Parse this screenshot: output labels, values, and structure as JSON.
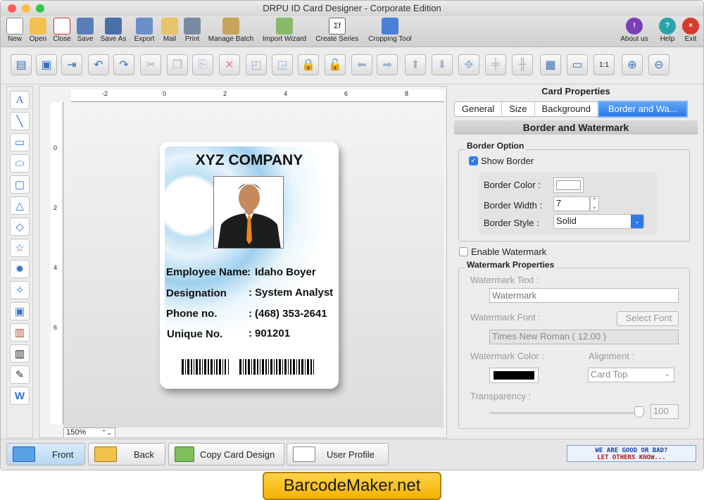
{
  "window": {
    "title": "DRPU ID Card Designer - Corporate Edition"
  },
  "toolbar": [
    {
      "label": "New",
      "icon": "new-icon"
    },
    {
      "label": "Open",
      "icon": "open-icon"
    },
    {
      "label": "Close",
      "icon": "close-file-icon"
    },
    {
      "label": "Save",
      "icon": "save-icon"
    },
    {
      "label": "Save As",
      "icon": "save-as-icon"
    },
    {
      "label": "Export",
      "icon": "export-icon"
    },
    {
      "label": "Mail",
      "icon": "mail-icon"
    },
    {
      "label": "Print",
      "icon": "print-icon"
    },
    {
      "label": "Manage Batch",
      "icon": "batch-icon"
    },
    {
      "label": "Import Wizard",
      "icon": "import-wizard-icon"
    },
    {
      "label": "Create Series",
      "icon": "series-icon"
    },
    {
      "label": "Cropping Tool",
      "icon": "crop-icon"
    },
    {
      "label": "About us",
      "icon": "about-icon"
    },
    {
      "label": "Help",
      "icon": "help-icon"
    },
    {
      "label": "Exit",
      "icon": "exit-icon"
    }
  ],
  "card": {
    "company": "XYZ COMPANY",
    "rows": [
      {
        "label": "Employee Name",
        "sep": ":",
        "value": "Idaho Boyer"
      },
      {
        "label": "Designation",
        "sep": ":",
        "value": "System Analyst"
      },
      {
        "label": "Phone no.",
        "sep": ":",
        "value": "(468) 353-2641"
      },
      {
        "label": "Unique No.",
        "sep": ":",
        "value": "901201"
      }
    ]
  },
  "canvas": {
    "zoom": "150%",
    "ruler_top": [
      "-2",
      "0",
      "2",
      "4",
      "6",
      "8"
    ],
    "ruler_left": [
      "0",
      "2",
      "4",
      "6"
    ]
  },
  "props": {
    "title": "Card Properties",
    "tabs": [
      "General",
      "Size",
      "Background",
      "Border and Wa..."
    ],
    "section": "Border and Watermark",
    "border_option": "Border Option",
    "show_border": "Show Border",
    "border_color_label": "Border Color :",
    "border_width_label": "Border Width :",
    "border_width_value": "7",
    "border_style_label": "Border Style :",
    "border_style_value": "Solid",
    "enable_watermark": "Enable Watermark",
    "wm_props": "Watermark Properties",
    "wm_text_label": "Watermark Text :",
    "wm_text_placeholder": "Watermark",
    "wm_font_label": "Watermark Font :",
    "select_font": "Select Font",
    "wm_font_value": "Times New Roman ( 12.00 )",
    "wm_color_label": "Watermark Color :",
    "alignment_label": "Alignment :",
    "alignment_value": "Card Top",
    "transparency_label": "Transparency :",
    "transparency_value": "100",
    "colors": {
      "border_color": "#ffffff",
      "watermark_color": "#000000"
    }
  },
  "bottom": {
    "front": "Front",
    "back": "Back",
    "copy": "Copy Card Design",
    "profile": "User Profile",
    "promo_line1": "WE ARE GOOD OR BAD?",
    "promo_line2": "LET OTHERS KNOW..."
  },
  "brand": "BarcodeMaker.net"
}
